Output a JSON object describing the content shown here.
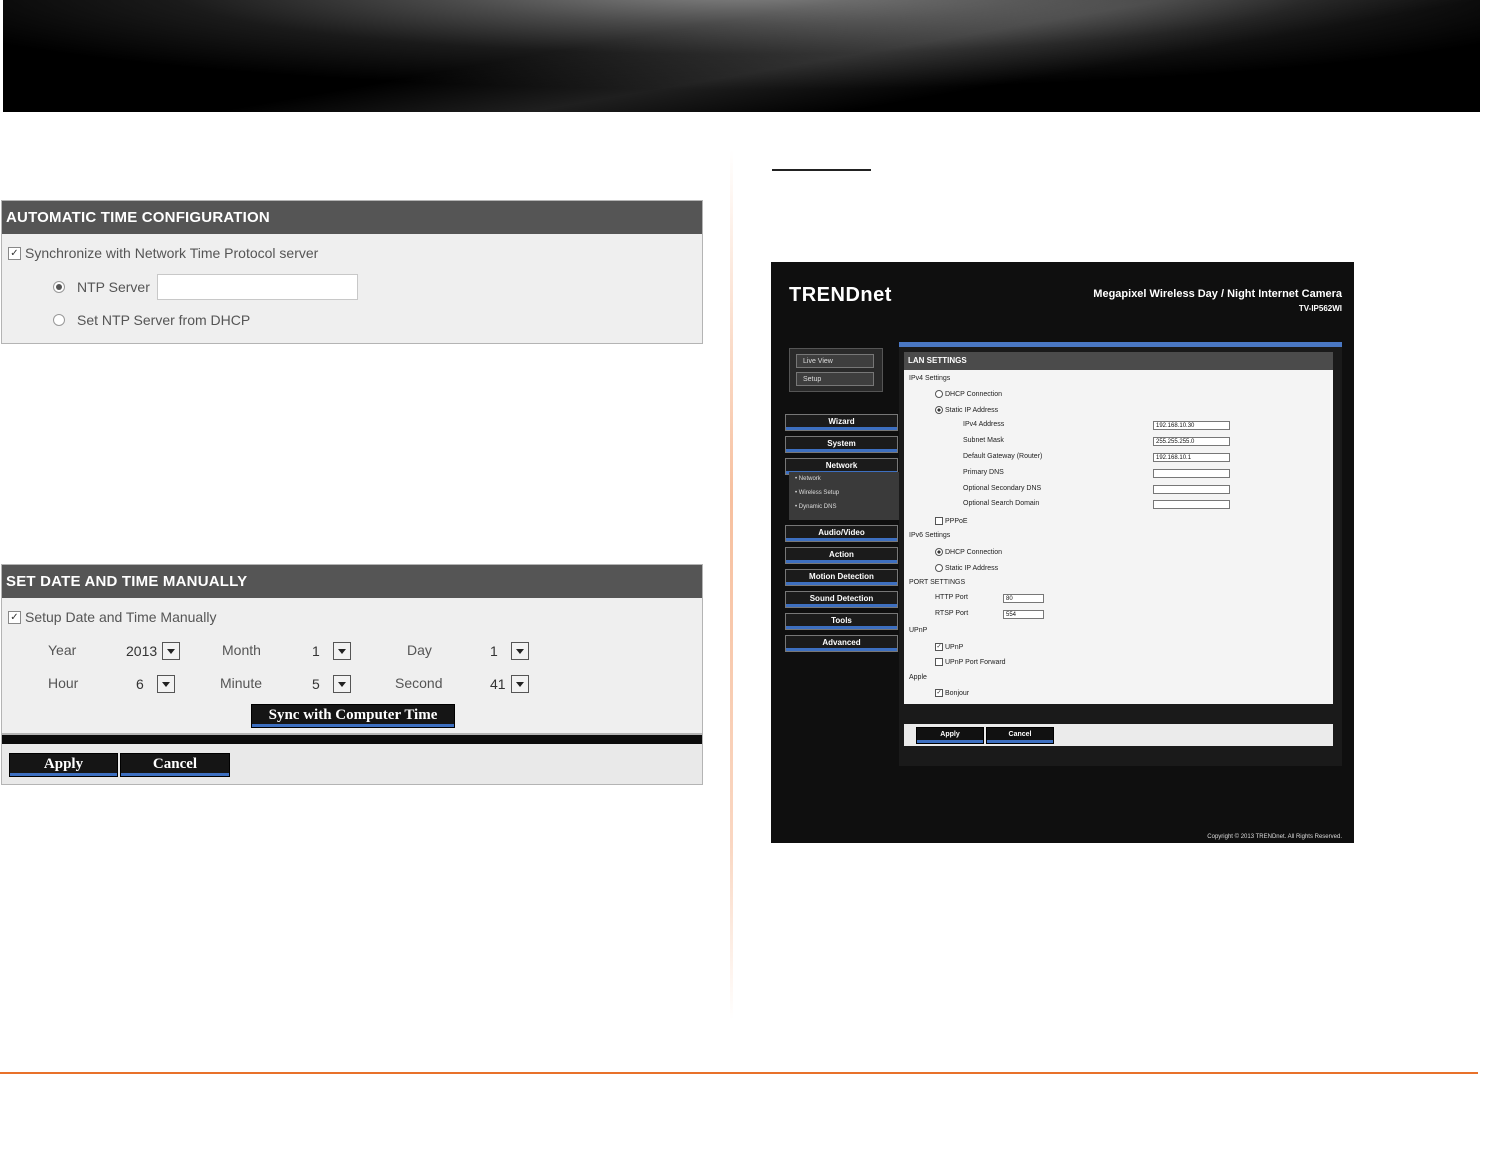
{
  "auto_time": {
    "title": "AUTOMATIC TIME CONFIGURATION",
    "sync_label": "Synchronize with Network Time Protocol server",
    "ntp_server_label": "NTP Server",
    "ntp_server_value": "",
    "dhcp_label": "Set NTP Server from DHCP"
  },
  "manual_time": {
    "title": "SET DATE AND TIME MANUALLY",
    "setup_label": "Setup Date and Time Manually",
    "year_label": "Year",
    "year_value": "2013",
    "month_label": "Month",
    "month_value": "1",
    "day_label": "Day",
    "day_value": "1",
    "hour_label": "Hour",
    "hour_value": "6",
    "minute_label": "Minute",
    "minute_value": "5",
    "second_label": "Second",
    "second_value": "41",
    "sync_button": "Sync with Computer Time"
  },
  "actions": {
    "apply": "Apply",
    "cancel": "Cancel"
  },
  "camera": {
    "logo": "TRENDnet",
    "product_name": "Megapixel Wireless Day / Night Internet Camera",
    "model": "TV-IP562WI",
    "live_view": "Live View",
    "setup": "Setup",
    "nav": [
      "Wizard",
      "System",
      "Network",
      "Audio/Video",
      "Action",
      "Motion Detection",
      "Sound Detection",
      "Tools",
      "Advanced"
    ],
    "subnav": [
      "• Network",
      "• Wireless Setup",
      "• Dynamic DNS"
    ],
    "lan_title": "LAN SETTINGS",
    "ipv4_settings": "IPv4 Settings",
    "dhcp_connection": "DHCP Connection",
    "static_ip": "Static IP Address",
    "ipv4_address_label": "IPv4 Address",
    "ipv4_address": "192.168.10.30",
    "subnet_label": "Subnet Mask",
    "subnet": "255.255.255.0",
    "gateway_label": "Default Gateway (Router)",
    "gateway": "192.168.10.1",
    "dns_label": "Primary DNS",
    "dns": "",
    "dns2_label": "Optional Secondary DNS",
    "dns2": "",
    "search_label": "Optional Search Domain",
    "search": "",
    "pppoe": "PPPoE",
    "ipv6_settings": "IPv6 Settings",
    "ipv6_dhcp": "DHCP Connection",
    "ipv6_static": "Static IP Address",
    "port_settings": "PORT SETTINGS",
    "http_label": "HTTP Port",
    "http_port": "80",
    "rtsp_label": "RTSP Port",
    "rtsp_port": "554",
    "upnp_section": "UPnP",
    "upnp": "UPnP",
    "upnp_forward": "UPnP Port Forward",
    "apple_section": "Apple",
    "bonjour": "Bonjour",
    "apply": "Apply",
    "cancel": "Cancel",
    "copyright": "Copyright © 2013 TRENDnet. All Rights Reserved."
  }
}
